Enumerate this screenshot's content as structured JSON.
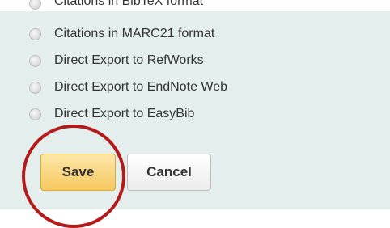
{
  "export_options": {
    "items": [
      {
        "label": "Citations in BibTeX format"
      },
      {
        "label": "Citations in MARC21 format"
      },
      {
        "label": "Direct Export to RefWorks"
      },
      {
        "label": "Direct Export to EndNote Web"
      },
      {
        "label": "Direct Export to EasyBib"
      }
    ]
  },
  "actions": {
    "save_label": "Save",
    "cancel_label": "Cancel"
  },
  "annotation": {
    "highlight_color": "#b31b1b"
  }
}
